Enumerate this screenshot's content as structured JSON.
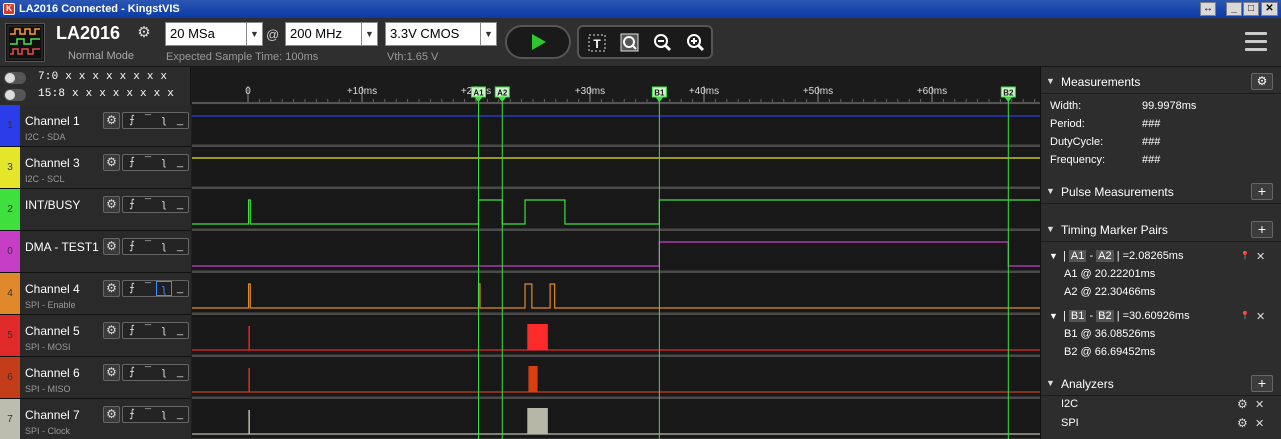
{
  "window": {
    "title": "LA2016 Connected - KingstVIS",
    "btn_restore": "↔",
    "btn_min": "_",
    "btn_max": "□",
    "btn_close": "✕"
  },
  "toolbar": {
    "device_name": "LA2016",
    "device_mode": "Normal Mode",
    "sample_depth": "20 MSa",
    "at": "@",
    "sample_rate": "200 MHz",
    "expected_time": "Expected Sample Time: 100ms",
    "threshold": "3.3V CMOS",
    "vth": "Vth:1.65 V",
    "run_icon": "play-icon",
    "tools": {
      "text_tool": "T",
      "zoom_fit": "⛶",
      "zoom_out": "−",
      "zoom_in": "+"
    }
  },
  "buses": [
    {
      "label": "7:0  x x x x x x x x"
    },
    {
      "label": "15:8  x x x x x x x x"
    }
  ],
  "channels": [
    {
      "num": "1",
      "name": "Channel 1",
      "sub": "I2C - SDA",
      "color": "#2a3de8"
    },
    {
      "num": "3",
      "name": "Channel 3",
      "sub": "I2C - SCL",
      "color": "#e5e52a"
    },
    {
      "num": "2",
      "name": "INT/BUSY",
      "sub": "",
      "color": "#3ee03e"
    },
    {
      "num": "0",
      "name": "DMA - TEST1",
      "sub": "",
      "color": "#c53ec5"
    },
    {
      "num": "4",
      "name": "Channel 4",
      "sub": "SPI - Enable",
      "color": "#e0892a"
    },
    {
      "num": "5",
      "name": "Channel 5",
      "sub": "SPI - MOSI",
      "color": "#e02a2a"
    },
    {
      "num": "6",
      "name": "Channel 6",
      "sub": "SPI - MISO",
      "color": "#c43d1a"
    },
    {
      "num": "7",
      "name": "Channel 7",
      "sub": "SPI - Clock",
      "color": "#bdbdaf"
    }
  ],
  "ruler": {
    "ticks": [
      {
        "t": 0,
        "label": "0"
      },
      {
        "t": 10,
        "label": "+10ms"
      },
      {
        "t": 20,
        "label": "+20ms"
      },
      {
        "t": 30,
        "label": "+30ms"
      },
      {
        "t": 40,
        "label": "+40ms"
      },
      {
        "t": 50,
        "label": "+50ms"
      },
      {
        "t": 60,
        "label": "+60ms"
      }
    ]
  },
  "markers": [
    {
      "name": "A1",
      "t_ms": 20.22201
    },
    {
      "name": "A2",
      "t_ms": 22.30466
    },
    {
      "name": "B1",
      "t_ms": 36.08526
    },
    {
      "name": "B2",
      "t_ms": 66.69452
    }
  ],
  "measurements": {
    "title": "Measurements",
    "rows": [
      {
        "k": "Width:",
        "v": "99.9978ms"
      },
      {
        "k": "Period:",
        "v": "###"
      },
      {
        "k": "DutyCycle:",
        "v": "###"
      },
      {
        "k": "Frequency:",
        "v": "###"
      }
    ]
  },
  "pulse": {
    "title": "Pulse Measurements"
  },
  "timing": {
    "title": "Timing Marker Pairs",
    "pairs": [
      {
        "a": "A1",
        "b": "A2",
        "delta": "=2.08265ms",
        "l1": "A1 @ 20.22201ms",
        "l2": "A2 @ 22.30466ms"
      },
      {
        "a": "B1",
        "b": "B2",
        "delta": "=30.60926ms",
        "l1": "B1 @ 36.08526ms",
        "l2": "B2 @ 66.69452ms"
      }
    ]
  },
  "analyzers": {
    "title": "Analyzers",
    "items": [
      "I2C",
      "SPI"
    ]
  }
}
